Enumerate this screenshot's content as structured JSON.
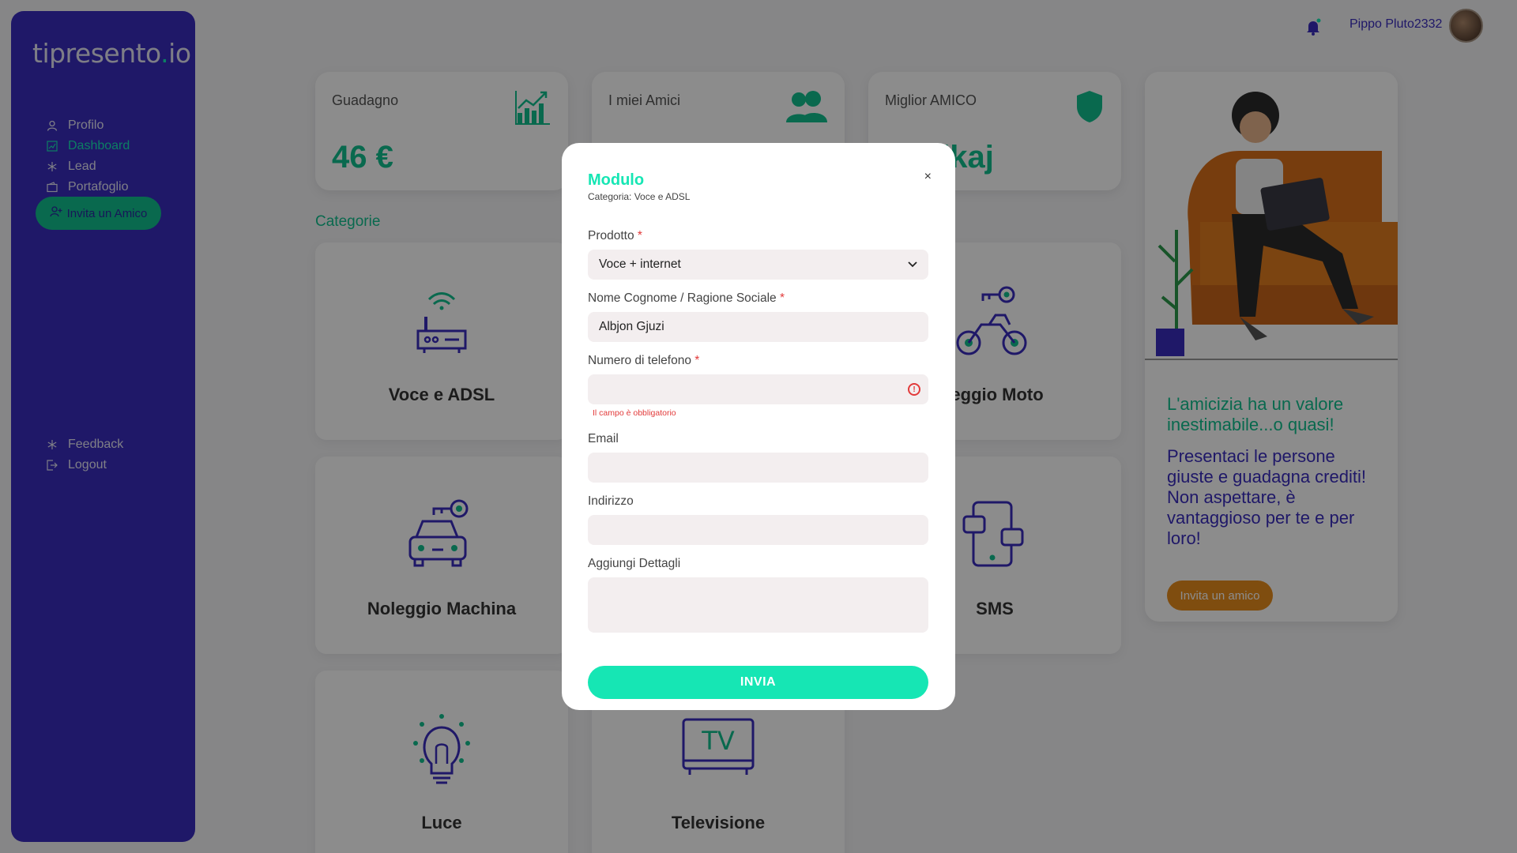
{
  "app": {
    "logo_main": "tipresento",
    "logo_dot": ".",
    "logo_tld": "io"
  },
  "sidebar": {
    "items": [
      {
        "label": "Profilo",
        "icon": "user-icon"
      },
      {
        "label": "Dashboard",
        "icon": "chart-icon",
        "active": true
      },
      {
        "label": "Lead",
        "icon": "snowflake-icon"
      },
      {
        "label": "Portafoglio",
        "icon": "wallet-icon"
      }
    ],
    "invite_label": "Invita un Amico",
    "bottom_items": [
      {
        "label": "Feedback",
        "icon": "sparkle-icon"
      },
      {
        "label": "Logout",
        "icon": "logout-icon"
      }
    ]
  },
  "header": {
    "username": "Pippo Pluto2332"
  },
  "stats": [
    {
      "label": "Guadagno",
      "value": "46 €",
      "icon": "chart-growth-icon"
    },
    {
      "label": "I miei Amici",
      "value": "",
      "icon": "users-icon"
    },
    {
      "label": "Miglior AMICO",
      "value": "ol Likaj",
      "icon": "shield-icon"
    }
  ],
  "categories_title": "Categorie",
  "categories": [
    {
      "label": "Voce e ADSL",
      "icon": "router-icon"
    },
    {
      "label": "leggio Moto",
      "icon": "motorbike-icon"
    },
    {
      "label": "Noleggio Machina",
      "icon": "car-key-icon"
    },
    {
      "label": "SMS",
      "icon": "phone-sms-icon"
    },
    {
      "label": "Luce",
      "icon": "bulb-icon"
    },
    {
      "label": "Televisione",
      "icon": "tv-icon"
    }
  ],
  "promo": {
    "heading": "L'amicizia ha un valore inestimabile...o quasi!",
    "body": "Presentaci le persone giuste e guadagna crediti!\nNon aspettare, è vantaggioso per te e per loro!",
    "button": "Invita un amico"
  },
  "modal": {
    "title": "Modulo",
    "subtitle": "Categoria: Voce e ADSL",
    "close": "×",
    "fields": {
      "prodotto": {
        "label": "Prodotto",
        "required": "*",
        "value": "Voce + internet"
      },
      "nome": {
        "label": "Nome Cognome / Ragione Sociale",
        "required": "*",
        "value": "Albjon Gjuzi"
      },
      "telefono": {
        "label": "Numero di telefono",
        "required": "*",
        "value": "",
        "error": "Il campo è obbligatorio"
      },
      "email": {
        "label": "Email",
        "value": ""
      },
      "indirizzo": {
        "label": "Indirizzo",
        "value": ""
      },
      "dettagli": {
        "label": "Aggiungi Dettagli",
        "value": ""
      }
    },
    "submit": "INVIA"
  },
  "colors": {
    "primary": "#3a2cbe",
    "accent": "#16e6b4",
    "green": "#12c08f",
    "orange": "#e88c1c",
    "error": "#e23a3a"
  }
}
